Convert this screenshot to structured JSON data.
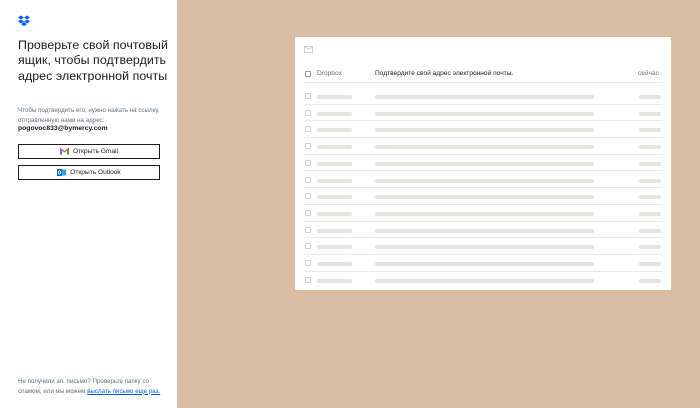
{
  "left": {
    "heading": "Проверьте свой почтовый ящик, чтобы подтвердить адрес электронной почты",
    "description": "Чтобы подтвердить его, нужно нажать на ссылку, отправленную нами на адрес:",
    "email": "pogovoc833@bymercy.com",
    "buttons": {
      "gmail": "Открыть Gmail",
      "outlook": "Открыть Outlook"
    },
    "footer_text": "Не получили эл. письмо? Проверьте папку со спамом, или мы можем",
    "footer_link": "выслать письмо еще раз."
  },
  "inbox": {
    "first_row": {
      "sender": "Dropbox",
      "subject": "Подтвердите свой адрес электронной почты.",
      "time": "сейчас"
    },
    "placeholder_rows": 12
  },
  "colors": {
    "right_background": "#d9bea3",
    "brand_blue": "#0061fe",
    "gmail_red": "#ea4335",
    "outlook_blue": "#0a64ad"
  },
  "icons": [
    "dropbox-logo-icon",
    "gmail-icon",
    "outlook-icon",
    "envelope-icon"
  ]
}
